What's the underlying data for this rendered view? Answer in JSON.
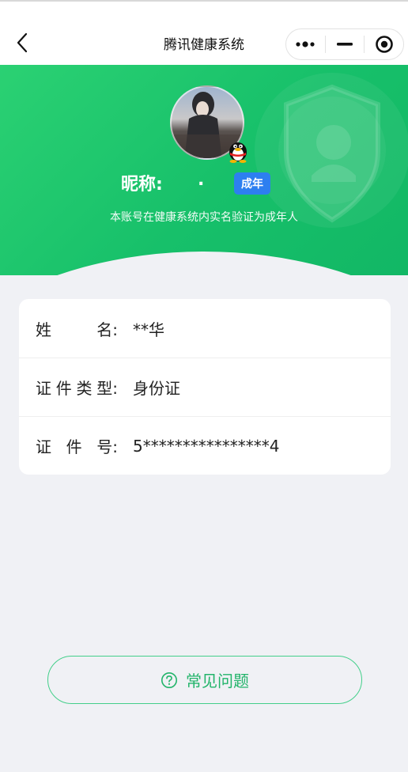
{
  "nav": {
    "title": "腾讯健康系统"
  },
  "profile": {
    "nickname_label": "昵称:",
    "nickname_value": ".",
    "age_badge": "成年",
    "verify_text": "本账号在健康系统内实名验证为成年人"
  },
  "info": {
    "rows": [
      {
        "label": [
          "姓",
          "名:"
        ],
        "value": "**华"
      },
      {
        "label": [
          "证",
          "件",
          "类",
          "型:"
        ],
        "value": "身份证"
      },
      {
        "label": [
          "证",
          "件",
          "号:"
        ],
        "value": "5****************4"
      }
    ]
  },
  "faq": {
    "label": "常见问题"
  },
  "colors": {
    "brand_green": "#17c06a",
    "badge_blue": "#2d7ff0"
  }
}
